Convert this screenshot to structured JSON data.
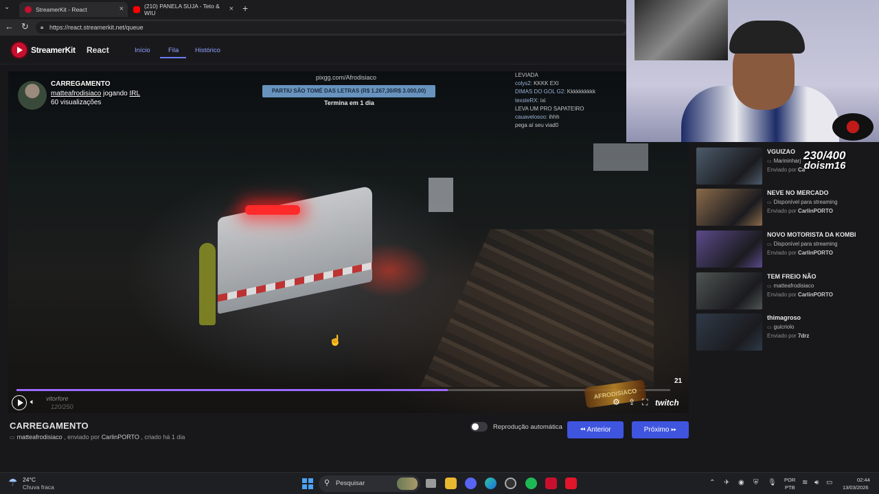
{
  "browser": {
    "tabs": [
      {
        "label": "StreamerKit - React",
        "active": true,
        "icon": "streamerkit-icon",
        "color": "#c8102e"
      },
      {
        "label": "(210) PANELA SUJA - Teto & WIU",
        "active": false,
        "icon": "youtube-icon",
        "color": "#ff0000"
      }
    ],
    "url": "https://react.streamerkit.net/queue"
  },
  "app": {
    "logo_text": "StreamerKit",
    "logo_suffix": "React",
    "nav": [
      {
        "label": "Início",
        "active": false
      },
      {
        "label": "Fila",
        "active": true
      },
      {
        "label": "Histórico",
        "active": false
      }
    ],
    "accent": "#3f55e0"
  },
  "video": {
    "clip_title": "CARREGAMENTO",
    "channel": "matteafrodisiaco",
    "playing_word": "jogando",
    "category": "IRL",
    "views": "60 visualizações",
    "overlay_url": "pixgg.com/Afrodisiaco",
    "overlay_banner": "PARTIU SÃO TOMÉ DAS LETRAS (R$ 1.267,30/R$ 3.000,00)",
    "overlay_timer": "Termina em 1 dia",
    "chat": [
      {
        "user": "",
        "text": "LEVIADA",
        "red": false
      },
      {
        "user": "colys2:",
        "text": "KKKK EXI",
        "red": false
      },
      {
        "user": "DIMAS DO GOL G2:",
        "text": "Kkkkkkkkkk",
        "red": false
      },
      {
        "user": "texsteRX:",
        "text": "ixi",
        "red": false
      },
      {
        "user": "",
        "text": "LEVA UM PRO SAPATEIRO",
        "red": true
      },
      {
        "user": "cauavelosoo:",
        "text": "ihhh",
        "red": false
      },
      {
        "user": "",
        "text": "pega aí seu viad0",
        "red": true
      }
    ],
    "counter": "21",
    "progress": 0.66,
    "goal_user": "vitorfore",
    "goal_count": "120/250",
    "watermark": "AFRODISIACO",
    "twitch": "twitch"
  },
  "clip_info": {
    "title": "CARREGAMENTO",
    "channel": "matteafrodisiaco",
    "sent_by_prefix": ", enviado por",
    "sender": "CarlinPORTO",
    "created": ", criado há 1 dia"
  },
  "controls": {
    "autoplay_label": "Reprodução automática",
    "autoplay_on": false,
    "prev_label": "Anterior",
    "next_label": "Próximo"
  },
  "queue": [
    {
      "title": "VGUIZAO",
      "channel": "Marininharj",
      "sent_prefix": "Enviado por",
      "sender": "Ca",
      "thumb": "#4b5b6a"
    },
    {
      "title": "NEVE NO MERCADO",
      "channel": "Disponível para streaming",
      "sent_prefix": "Enviado por",
      "sender": "CarlinPORTO",
      "thumb": "#8a6a4a"
    },
    {
      "title": "NOVO MOTORISTA DA KOMBI",
      "channel": "Disponível para streaming",
      "sent_prefix": "Enviado por",
      "sender": "CarlinPORTO",
      "thumb": "#5b4a8a"
    },
    {
      "title": "TEM FREIO NÃO",
      "channel": "matteafrodisiaco",
      "sent_prefix": "Enviado por",
      "sender": "CarlinPORTO",
      "thumb": "#4e5552"
    },
    {
      "title": "thimagroso",
      "channel": "guicriolo",
      "sent_prefix": "Enviado por",
      "sender": "7drz",
      "thumb": "#2f3a48"
    }
  ],
  "stream_goal": {
    "count": "230/400",
    "user": "doism16"
  },
  "taskbar": {
    "weather_temp": "24°C",
    "weather_desc": "Chuva fraca",
    "search_label": "Pesquisar",
    "lang_top": "POR",
    "lang_bottom": "PTB",
    "time": "02:44",
    "date": "13/03/2026"
  }
}
